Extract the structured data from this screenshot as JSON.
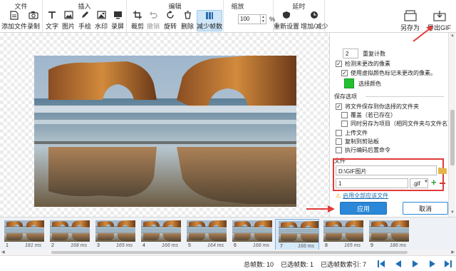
{
  "ribbon": {
    "groups": {
      "file": "文件",
      "insert": "插入",
      "edit": "编辑",
      "zoom": "缩放",
      "delay": "延时"
    },
    "buttons": {
      "add_file": "添加文件",
      "record": "录制",
      "text": "文字",
      "image": "图片",
      "brush": "手绘",
      "watermark": "水印",
      "blank": "录屏",
      "crop": "裁剪",
      "undo": "撤销",
      "rotate": "旋转",
      "delete": "删除",
      "reduce_frames": "减少帧数",
      "reset": "重新设置",
      "add_reduce": "增加/减少",
      "save_as": "另存为",
      "export_gif": "导出GIF"
    },
    "zoom_value": "100",
    "zoom_unit": "%"
  },
  "panel": {
    "repeat_count_value": "2",
    "repeat_count_label": "重复计数",
    "detect_unchanged": "检测未更改的像素",
    "use_color_mark": "使用虚拟颜色标记未更改的像素。",
    "select_color": "选择颜色",
    "mark_color": "#22c02e",
    "save_options_title": "保存选项",
    "save_to_folder": "将文件保存到你选择的文件夹",
    "overwrite": "覆盖（若已存在）",
    "save_as_project": "同时另存为项目（相同文件夹与文件名）",
    "upload_file": "上传文件",
    "copy_clipboard": "复制到剪贴板",
    "run_command": "执行编码后置命令",
    "file_title": "文件",
    "folder_path": "D:\\GIF图片",
    "file_name": "1",
    "extension": ".gif",
    "warning": "启用全部应该文件",
    "apply": "应用",
    "cancel": "取消"
  },
  "frames": [
    {
      "num": "1",
      "ms": "181 ms"
    },
    {
      "num": "2",
      "ms": "168 ms"
    },
    {
      "num": "3",
      "ms": "165 ms"
    },
    {
      "num": "4",
      "ms": "166 ms"
    },
    {
      "num": "5",
      "ms": "164 ms"
    },
    {
      "num": "6",
      "ms": "166 ms"
    },
    {
      "num": "7",
      "ms": "166 ms"
    },
    {
      "num": "8",
      "ms": "165 ms"
    },
    {
      "num": "9",
      "ms": "186 ms"
    }
  ],
  "selected_frame": "7",
  "status": {
    "total_frames": "总帧数: 10",
    "selected_frames": "已选帧数: 1",
    "selected_index": "已选帧数索引: 7"
  },
  "colors": {
    "accent": "#2b88d8",
    "annotation": "#e23a3a",
    "warning": "#f0a000"
  }
}
